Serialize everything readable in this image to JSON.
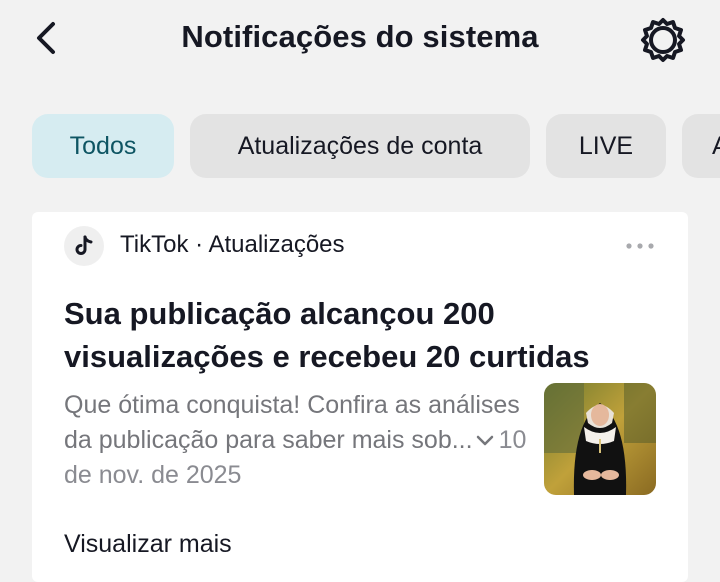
{
  "header": {
    "back_icon": "chevron-left-icon",
    "title": "Notificações do sistema",
    "settings_icon": "gear-icon"
  },
  "tabs": [
    {
      "label": "Todos",
      "active": true
    },
    {
      "label": "Atualizações de conta",
      "active": false
    },
    {
      "label": "LIVE",
      "active": false
    },
    {
      "label": "A",
      "active": false
    }
  ],
  "notification": {
    "app_icon": "tiktok-logo-icon",
    "source": "TikTok · Atualizações",
    "more_icon": "more-dots-icon",
    "headline": "Sua publicação alcançou 200 visualizações e recebeu 20 curtidas",
    "body": "Que ótima conquista! Confira as análises da publicação para saber mais sob...",
    "expand_icon": "chevron-down-icon",
    "date": "10 de nov. de 2025",
    "thumbnail_icon": "post-thumbnail-image",
    "view_more": "Visualizar mais"
  },
  "colors": {
    "background": "#f2f2f2",
    "card": "#ffffff",
    "active_tab_bg": "#d6ecf1",
    "active_tab_text": "#0e5563",
    "tab_bg": "#e3e3e3",
    "secondary_text": "#75767b"
  }
}
